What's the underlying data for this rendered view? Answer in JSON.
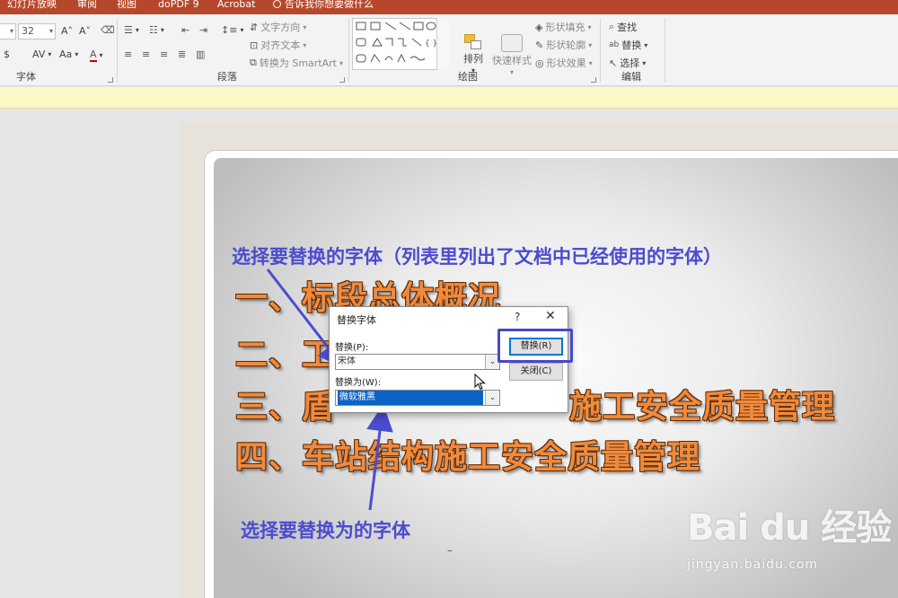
{
  "tabs": [
    "幻灯片放映",
    "审阅",
    "视图",
    "doPDF 9",
    "Acrobat"
  ],
  "tell_me": "告诉我你想要做什么",
  "ribbon": {
    "font": {
      "size": "32",
      "label": "字体",
      "grow": "A˄",
      "shrink": "A˅",
      "case": "Aa",
      "shadow": "$",
      "spacing": "AV"
    },
    "paragraph": {
      "label": "段落",
      "text_direction": "文字方向",
      "align_text": "对齐文本",
      "convert_smartart": "转换为 SmartArt"
    },
    "drawing": {
      "label": "绘图",
      "arrange": "排列",
      "quick_styles": "快速样式",
      "shape_fill": "形状填充",
      "shape_outline": "形状轮廓",
      "shape_effects": "形状效果"
    },
    "editing": {
      "label": "编辑",
      "find": "查找",
      "replace": "替换",
      "select": "选择"
    }
  },
  "slide": {
    "lines": [
      "一、标段总体概况",
      "二、工",
      "三、盾",
      "施工安全质量管理",
      "四、车站结构施工安全质量管理"
    ],
    "annotation_top": "选择要替换的字体（列表里列出了文档中已经使用的字体）",
    "annotation_bottom": "选择要替换为的字体",
    "page_dash": "–"
  },
  "dialog": {
    "title": "替换字体",
    "help": "?",
    "close": "✕",
    "replace_label": "替换(P):",
    "replace_value": "宋体",
    "with_label": "替换为(W):",
    "with_value": "微软雅黑",
    "replace_button": "替换(R)",
    "close_button": "关闭(C)"
  },
  "watermark": {
    "brand": "Bai du 经验",
    "url": "jingyan.baidu.com"
  },
  "colors": {
    "tab_bar": "#b7472a",
    "annotation": "#4b4ccf",
    "slide_text": "#f08a3c",
    "selection": "#0a64c8"
  }
}
